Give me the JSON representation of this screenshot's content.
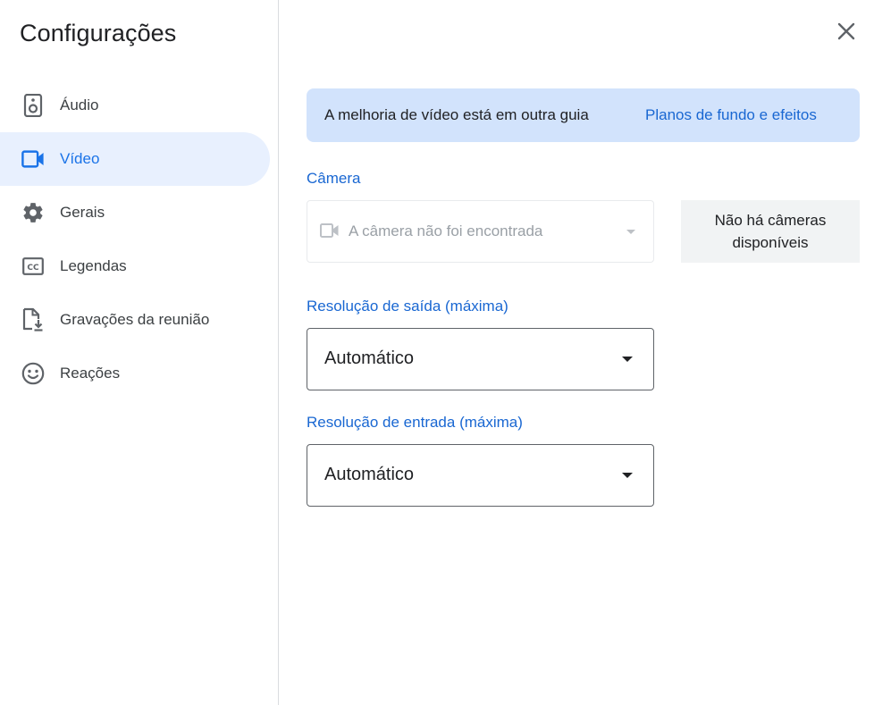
{
  "sidebar": {
    "title": "Configurações",
    "items": [
      {
        "label": "Áudio",
        "icon": "speaker-icon",
        "active": false
      },
      {
        "label": "Vídeo",
        "icon": "videocam-icon",
        "active": true
      },
      {
        "label": "Gerais",
        "icon": "gear-icon",
        "active": false
      },
      {
        "label": "Legendas",
        "icon": "closed-captions-icon",
        "active": false
      },
      {
        "label": "Gravações da reunião",
        "icon": "recording-file-icon",
        "active": false
      },
      {
        "label": "Reações",
        "icon": "smiley-icon",
        "active": false
      }
    ]
  },
  "banner": {
    "text": "A melhoria de vídeo está em outra guia",
    "link": "Planos de fundo e efeitos"
  },
  "camera": {
    "label": "Câmera",
    "value": "A câmera não foi encontrada",
    "preview_text": "Não há câmeras disponíveis"
  },
  "output_resolution": {
    "label": "Resolução de saída (máxima)",
    "value": "Automático"
  },
  "input_resolution": {
    "label": "Resolução de entrada (máxima)",
    "value": "Automático"
  },
  "colors": {
    "accent": "#1a73e8",
    "active_bg": "#e8f0fe",
    "banner_bg": "#d2e3fc"
  }
}
